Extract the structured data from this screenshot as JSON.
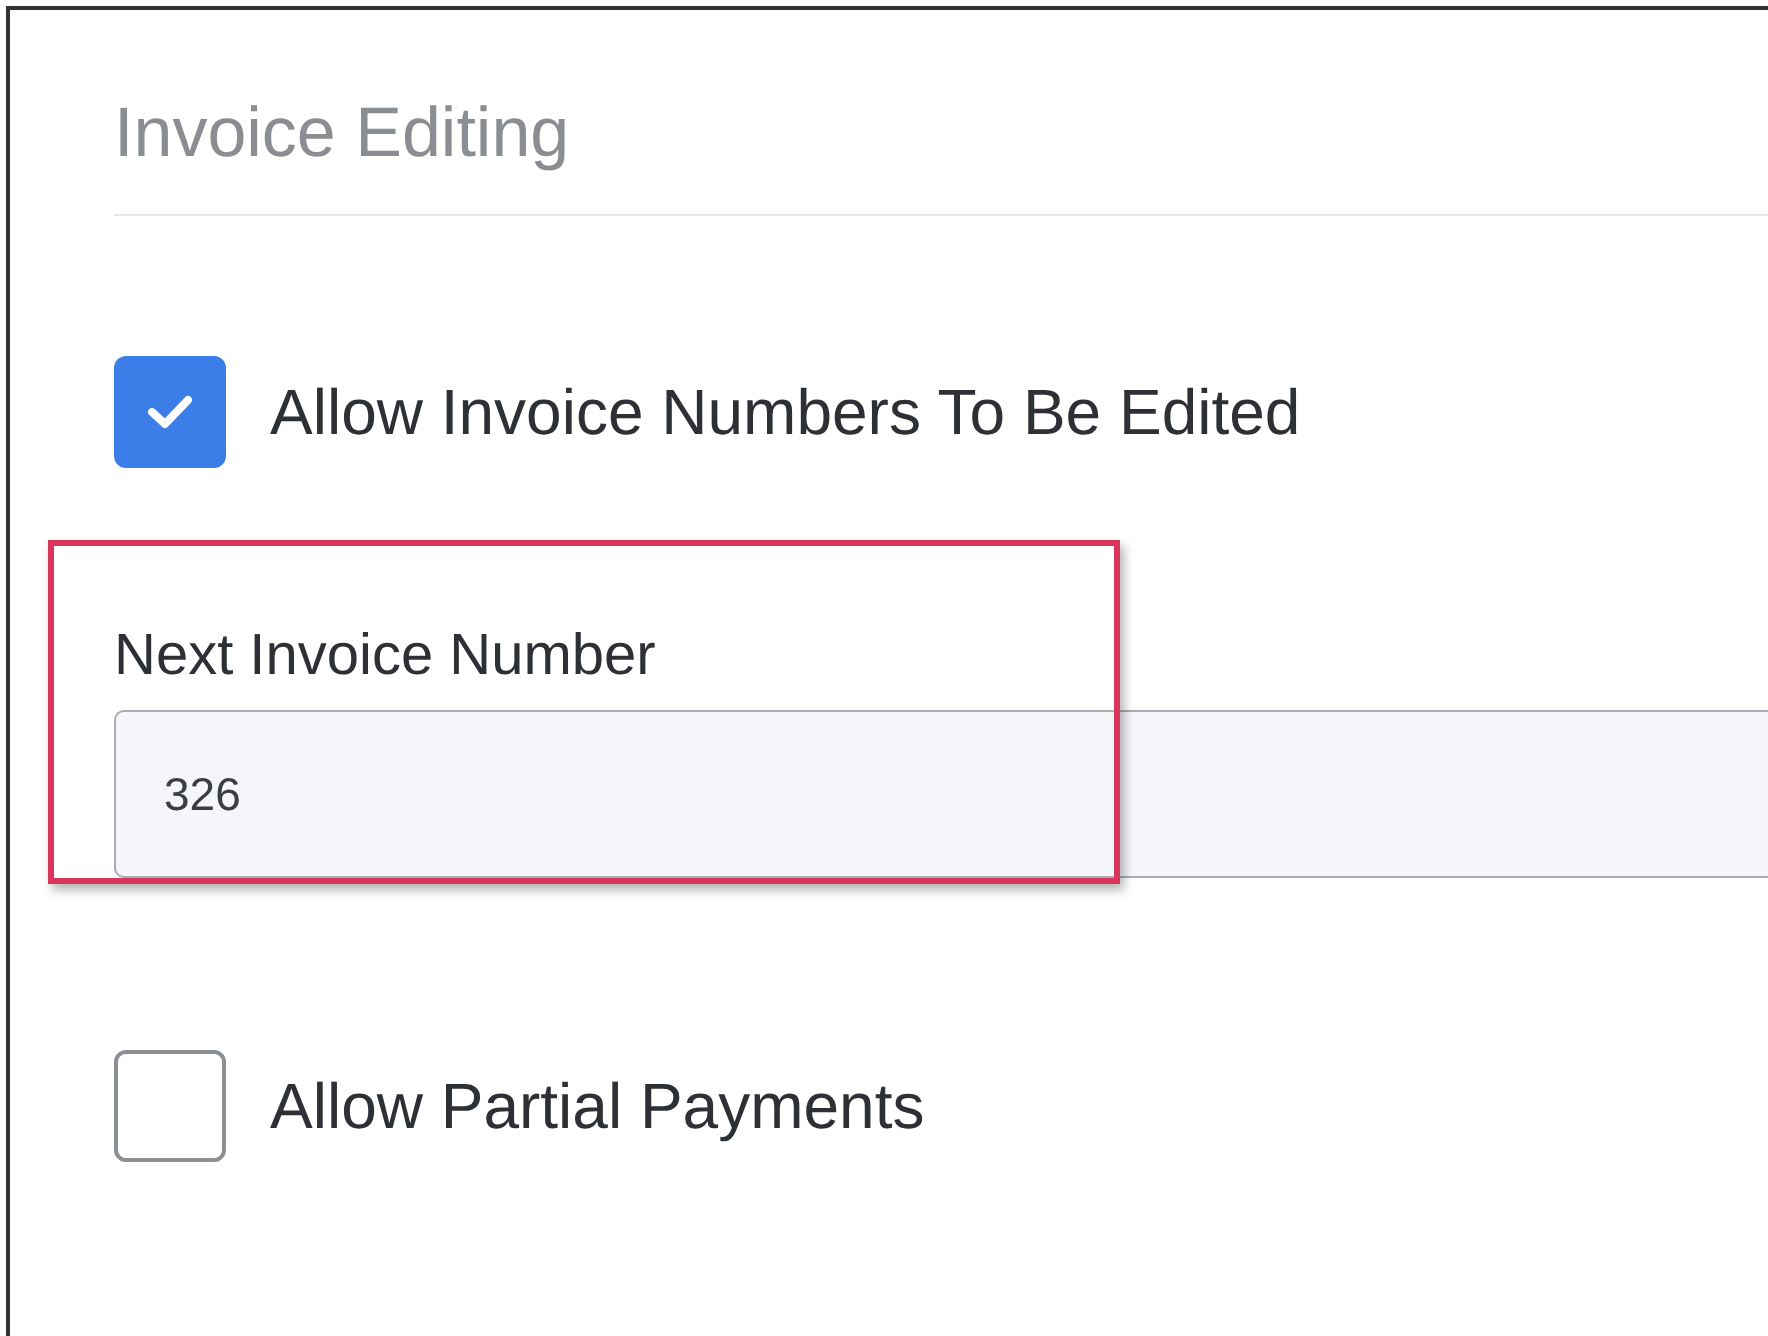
{
  "section": {
    "title": "Invoice Editing"
  },
  "settings": [
    {
      "kind": "checkbox",
      "label": "Allow Invoice Numbers To Be Edited",
      "checked": true
    },
    {
      "kind": "field",
      "label": "Next Invoice Number",
      "value": "326",
      "highlighted": true
    },
    {
      "kind": "checkbox",
      "label": "Allow Partial Payments",
      "checked": false
    }
  ]
}
